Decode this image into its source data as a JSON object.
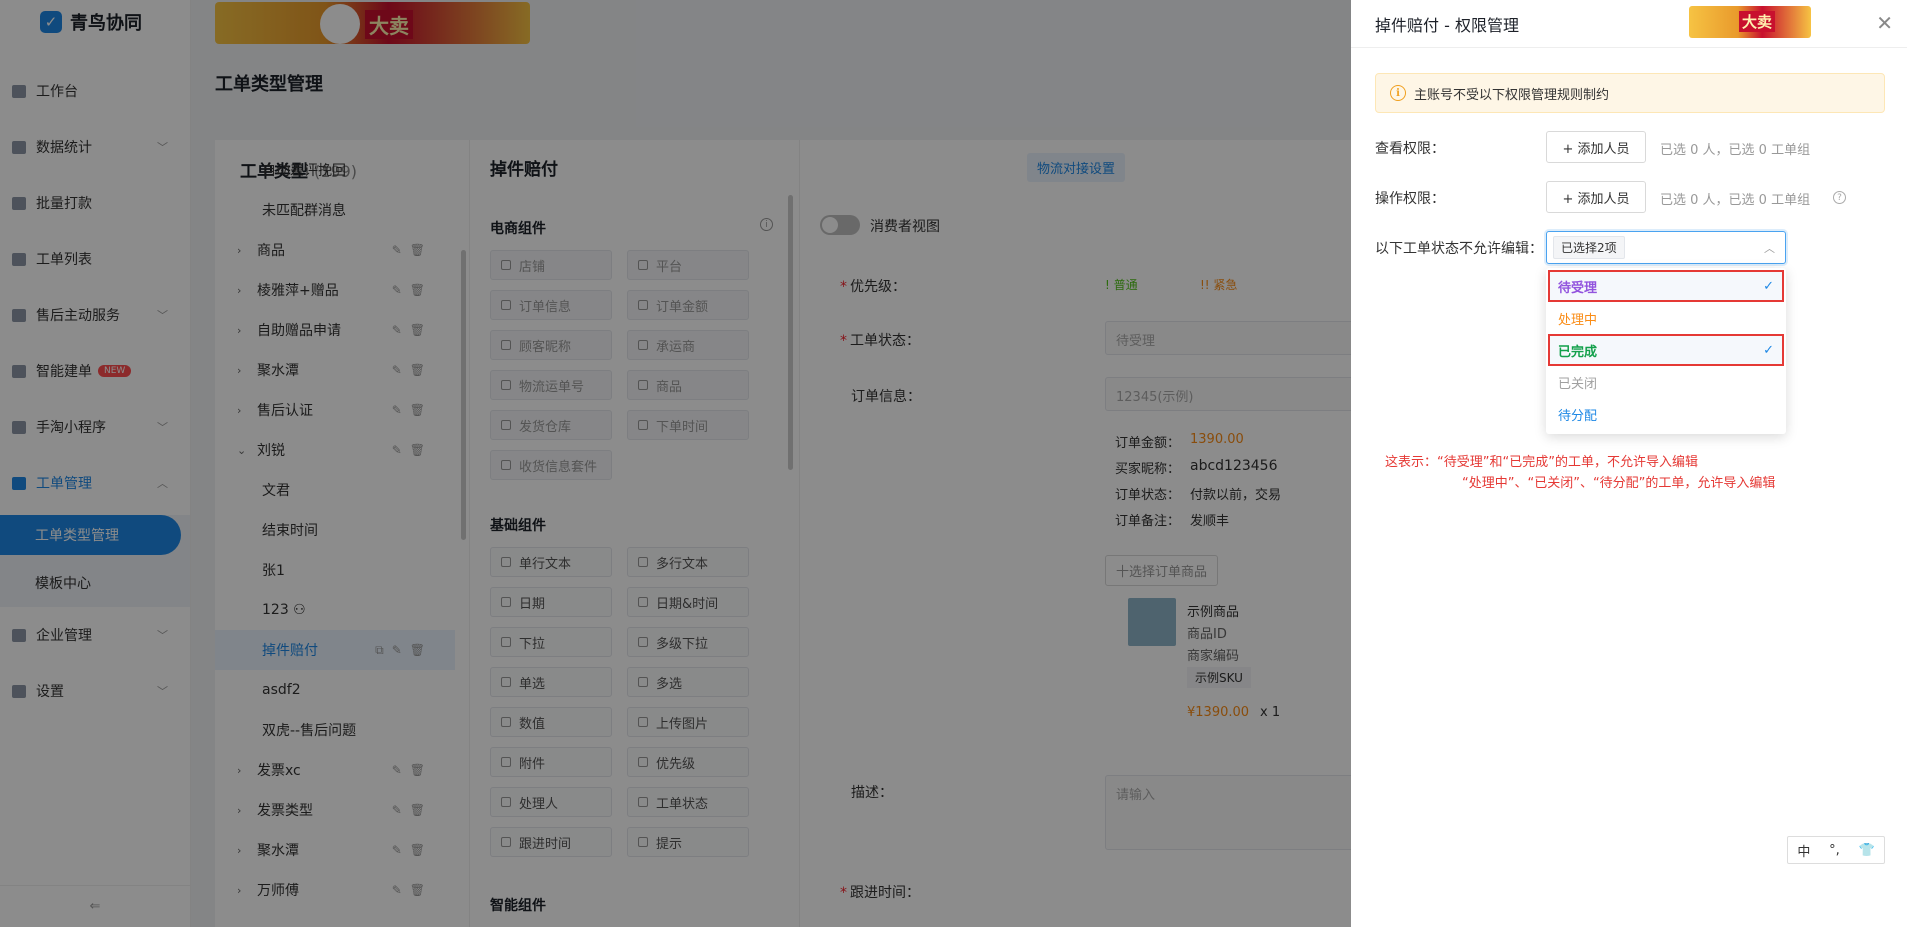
{
  "app": {
    "name": "青鸟协同",
    "banner_text": "大卖"
  },
  "sidebar": {
    "items": [
      {
        "label": "工作台",
        "chevron": false,
        "icon": "desktop-icon"
      },
      {
        "label": "数据统计",
        "chevron": true,
        "icon": "bar-chart-icon"
      },
      {
        "label": "批量打款",
        "chevron": false,
        "icon": "money-icon"
      },
      {
        "label": "工单列表",
        "chevron": false,
        "icon": "list-icon"
      },
      {
        "label": "售后主动服务",
        "chevron": true,
        "icon": "service-icon"
      },
      {
        "label": "智能建单",
        "chevron": false,
        "icon": "robot-icon",
        "badge": "NEW"
      },
      {
        "label": "手淘小程序",
        "chevron": true,
        "icon": "phone-icon"
      },
      {
        "label": "工单管理",
        "chevron": true,
        "icon": "ticket-icon",
        "active": true
      }
    ],
    "sub_items": [
      {
        "label": "工单类型管理",
        "selected": true
      },
      {
        "label": "模板中心",
        "selected": false
      }
    ],
    "items_after": [
      {
        "label": "企业管理",
        "icon": "building-icon"
      },
      {
        "label": "设置",
        "icon": "gear-icon"
      }
    ],
    "collapse_glyph": "⇐"
  },
  "page": {
    "title": "工单类型管理"
  },
  "types_panel": {
    "title": "工单类型",
    "count": "(199)",
    "rows": [
      {
        "label": "自动差评挽回",
        "arrow": "",
        "leaf": true,
        "actions": false
      },
      {
        "label": "未匹配群消息",
        "arrow": "",
        "leaf": true,
        "actions": false
      },
      {
        "label": "商品",
        "arrow": "›",
        "leaf": false,
        "actions": true
      },
      {
        "label": "棱雅萍+赠品",
        "arrow": "›",
        "leaf": false,
        "actions": true
      },
      {
        "label": "自助赠品申请",
        "arrow": "›",
        "leaf": false,
        "actions": true
      },
      {
        "label": "聚水潭",
        "arrow": "›",
        "leaf": false,
        "actions": true
      },
      {
        "label": "售后认证",
        "arrow": "›",
        "leaf": false,
        "actions": true
      },
      {
        "label": "刘锐",
        "arrow": "⌄",
        "leaf": false,
        "actions": true
      },
      {
        "label": "文君",
        "arrow": "",
        "leaf": true,
        "actions": false
      },
      {
        "label": "结束时间",
        "arrow": "",
        "leaf": true,
        "actions": false
      },
      {
        "label": "张1",
        "arrow": "",
        "leaf": true,
        "actions": false
      },
      {
        "label": "123 ⚇",
        "arrow": "",
        "leaf": true,
        "actions": false
      },
      {
        "label": "掉件赔付",
        "arrow": "",
        "leaf": true,
        "actions": true,
        "selected": true
      },
      {
        "label": "asdf2",
        "arrow": "",
        "leaf": true,
        "actions": false
      },
      {
        "label": "双虎--售后问题",
        "arrow": "",
        "leaf": true,
        "actions": false
      },
      {
        "label": "发票xc",
        "arrow": "›",
        "leaf": false,
        "actions": true
      },
      {
        "label": "发票类型",
        "arrow": "›",
        "leaf": false,
        "actions": true
      },
      {
        "label": "聚水潭",
        "arrow": "›",
        "leaf": false,
        "actions": true
      },
      {
        "label": "万师傅",
        "arrow": "›",
        "leaf": false,
        "actions": true
      }
    ]
  },
  "components_panel": {
    "title": "掉件赔付",
    "ecommerce_title": "电商组件",
    "ecommerce": [
      "店铺",
      "平台",
      "订单信息",
      "订单金额",
      "顾客昵称",
      "承运商",
      "物流运单号",
      "商品",
      "发货仓库",
      "下单时间",
      "收货信息套件"
    ],
    "basic_title": "基础组件",
    "basic": [
      "单行文本",
      "多行文本",
      "日期",
      "日期&时间",
      "下拉",
      "多级下拉",
      "单选",
      "多选",
      "数值",
      "上传图片",
      "附件",
      "优先级",
      "处理人",
      "工单状态",
      "跟进时间",
      "提示"
    ],
    "smart_title": "智能组件"
  },
  "form_preview": {
    "logistics_btn": "物流对接设置",
    "consumer_view": "消费者视图",
    "priority_label": "优先级：",
    "priority_normal": "! 普通",
    "priority_urgent": "!! 紧急",
    "status_label": "工单状态：",
    "status_value": "待受理",
    "order_label": "订单信息：",
    "order_placeholder": "12345(示例)",
    "order_amount_label": "订单金额：",
    "order_amount": "1390.00",
    "buyer_label": "买家昵称：",
    "buyer": "abcd123456",
    "order_status_label": "订单状态：",
    "order_status": "付款以前，交易",
    "order_note_label": "订单备注：",
    "order_note": "发顺丰",
    "choose_goods": "十选择订单商品",
    "goods_name": "示例商品",
    "goods_id": "商品ID",
    "goods_code": "商家编码",
    "goods_sku": "示例SKU",
    "goods_price": "¥1390.00",
    "goods_qty": "x 1",
    "desc_label": "描述：",
    "desc_placeholder": "请输入",
    "follow_label": "跟进时间："
  },
  "drawer": {
    "title": "掉件赔付 - 权限管理",
    "close": "✕",
    "notice": "主账号不受以下权限管理规则制约",
    "view_label": "查看权限：",
    "operate_label": "操作权限：",
    "add_btn": "+ 添加人员",
    "picked_view": "已选 0 人，已选 0 工单组",
    "picked_operate": "已选 0 人，已选 0 工单组",
    "lock_label": "以下工单状态不允许编辑：",
    "select_tag": "已选择2项",
    "options": [
      {
        "label": "待受理",
        "color": "#9254de",
        "checked": true
      },
      {
        "label": "处理中",
        "color": "#fa8c16",
        "checked": false
      },
      {
        "label": "已完成",
        "color": "#13a04b",
        "checked": true
      },
      {
        "label": "已关闭",
        "color": "#a0a0a0",
        "checked": false
      },
      {
        "label": "待分配",
        "color": "#1e88e5",
        "checked": false
      }
    ],
    "explain_line1": "这表示：“待受理”和“已完成”的工单，不允许导入编辑",
    "explain_line2": "“处理中”、“已关闭”、“待分配”的工单，允许导入编辑",
    "ime": [
      "中",
      "°,",
      "👕"
    ]
  }
}
